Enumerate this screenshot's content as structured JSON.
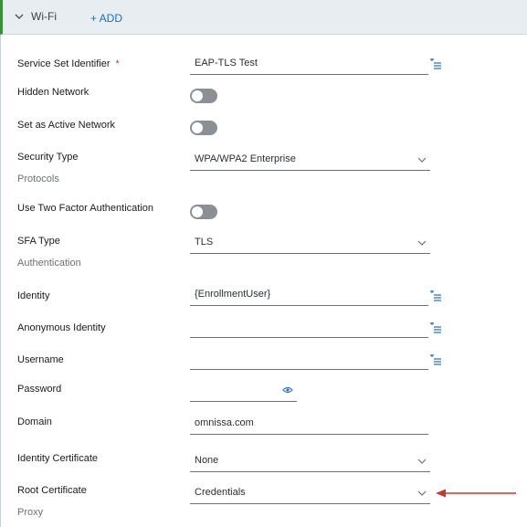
{
  "header": {
    "title": "Wi-Fi",
    "add_label": "+ ADD"
  },
  "fields": {
    "ssid": {
      "label": "Service Set Identifier",
      "required_mark": "*",
      "value": "EAP-TLS Test"
    },
    "hidden_network": {
      "label": "Hidden Network",
      "enabled": false
    },
    "active_network": {
      "label": "Set as Active Network",
      "enabled": false
    },
    "security_type": {
      "label": "Security Type",
      "value": "WPA/WPA2 Enterprise"
    },
    "protocols_section": "Protocols",
    "two_factor": {
      "label": "Use Two Factor Authentication",
      "enabled": false
    },
    "sfa_type": {
      "label": "SFA Type",
      "value": "TLS"
    },
    "authentication_section": "Authentication",
    "identity": {
      "label": "Identity",
      "value": "{EnrollmentUser}"
    },
    "anonymous_identity": {
      "label": "Anonymous Identity",
      "value": ""
    },
    "username": {
      "label": "Username",
      "value": ""
    },
    "password": {
      "label": "Password",
      "value": ""
    },
    "domain": {
      "label": "Domain",
      "value": "omnissa.com"
    },
    "identity_certificate": {
      "label": "Identity Certificate",
      "value": "None"
    },
    "root_certificate": {
      "label": "Root Certificate",
      "value": "Credentials"
    },
    "proxy_section": "Proxy"
  },
  "colors": {
    "accent_green": "#3c8d3c",
    "link_blue": "#1f6fb0",
    "arrow_red": "#c8372d",
    "icon_blue": "#2a74b8"
  }
}
